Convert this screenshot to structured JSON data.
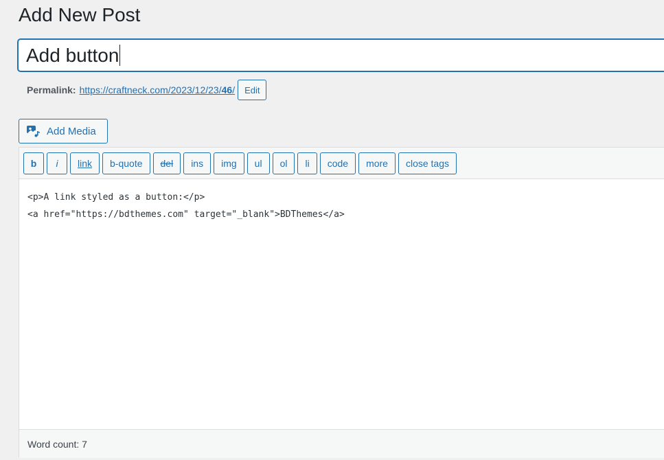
{
  "page": {
    "title": "Add New Post"
  },
  "post": {
    "title_value": "Add button"
  },
  "permalink": {
    "label": "Permalink:",
    "url_prefix": "https://craftneck.com/2023/12/23/",
    "url_slug": "46",
    "url_suffix": "/",
    "edit_label": "Edit"
  },
  "media": {
    "add_media_label": "Add Media",
    "icon": "add-media-icon"
  },
  "toolbar": {
    "buttons": [
      {
        "id": "b",
        "label": "b"
      },
      {
        "id": "i",
        "label": "i"
      },
      {
        "id": "link",
        "label": "link"
      },
      {
        "id": "b-quote",
        "label": "b-quote"
      },
      {
        "id": "del",
        "label": "del"
      },
      {
        "id": "ins",
        "label": "ins"
      },
      {
        "id": "img",
        "label": "img"
      },
      {
        "id": "ul",
        "label": "ul"
      },
      {
        "id": "ol",
        "label": "ol"
      },
      {
        "id": "li",
        "label": "li"
      },
      {
        "id": "code",
        "label": "code"
      },
      {
        "id": "more",
        "label": "more"
      },
      {
        "id": "close-tags",
        "label": "close tags"
      }
    ]
  },
  "editor": {
    "lines": [
      "<p>A link styled as a button:</p>",
      "<a href=\"https://bdthemes.com\" target=\"_blank\">BDThemes</a>"
    ]
  },
  "status": {
    "word_count": "Word count: 7"
  },
  "colors": {
    "accent": "#2271b1",
    "background": "#f0f0f1",
    "border": "#dcdcde"
  }
}
